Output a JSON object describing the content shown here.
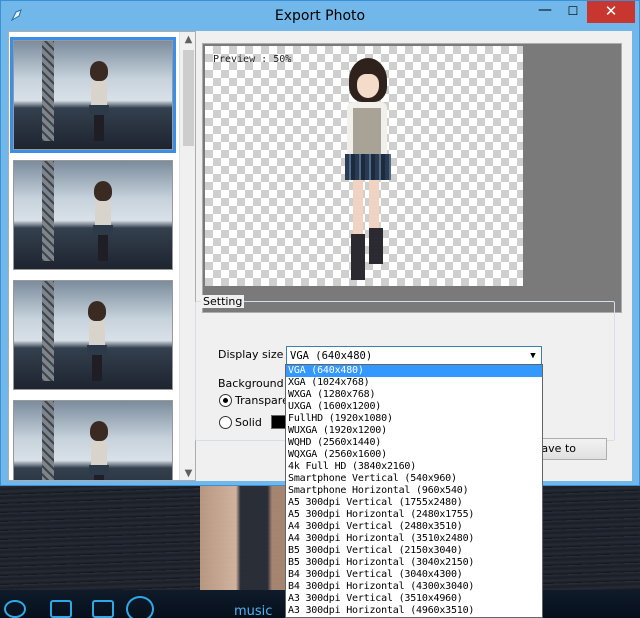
{
  "window": {
    "title": "Export Photo"
  },
  "titlebar": {
    "minimize": "—",
    "maximize": "☐",
    "close": "✕"
  },
  "preview": {
    "label": "Preview : 50%"
  },
  "setting": {
    "group_title": "Setting",
    "display_size_label": "Display size",
    "display_size_value": "VGA (640x480)",
    "background_label": "Background",
    "transparent_label": "Transparent",
    "solid_label": "Solid",
    "solid_color": "#000000",
    "save_button": "Save to the file"
  },
  "dropdown": {
    "options": [
      "VGA (640x480)",
      "XGA (1024x768)",
      "WXGA (1280x768)",
      "UXGA (1600x1200)",
      "FullHD (1920x1080)",
      "WUXGA (1920x1200)",
      "WQHD (2560x1440)",
      "WQXGA (2560x1600)",
      "4k Full HD (3840x2160)",
      "Smartphone Vertical (540x960)",
      "Smartphone Horizontal (960x540)",
      "A5 300dpi Vertical (1755x2480)",
      "A5 300dpi Horizontal (2480x1755)",
      "A4 300dpi Vertical (2480x3510)",
      "A4 300dpi Horizontal (3510x2480)",
      "B5 300dpi Vertical (2150x3040)",
      "B5 300dpi Horizontal (3040x2150)",
      "B4 300dpi Vertical (3040x4300)",
      "B4 300dpi Horizontal (4300x3040)",
      "A3 300dpi Vertical (3510x4960)",
      "A3 300dpi Horizontal (4960x3510)"
    ],
    "selected_index": 0
  },
  "background_app": {
    "music_label": "music"
  },
  "colors": {
    "titlebar": "#71b7ea",
    "close": "#c7372f",
    "selection": "#3399ff"
  },
  "icons": [
    "app-icon",
    "minimize-icon",
    "maximize-icon",
    "close-icon",
    "chevron-down-icon",
    "scroll-up-icon",
    "scroll-down-icon"
  ]
}
